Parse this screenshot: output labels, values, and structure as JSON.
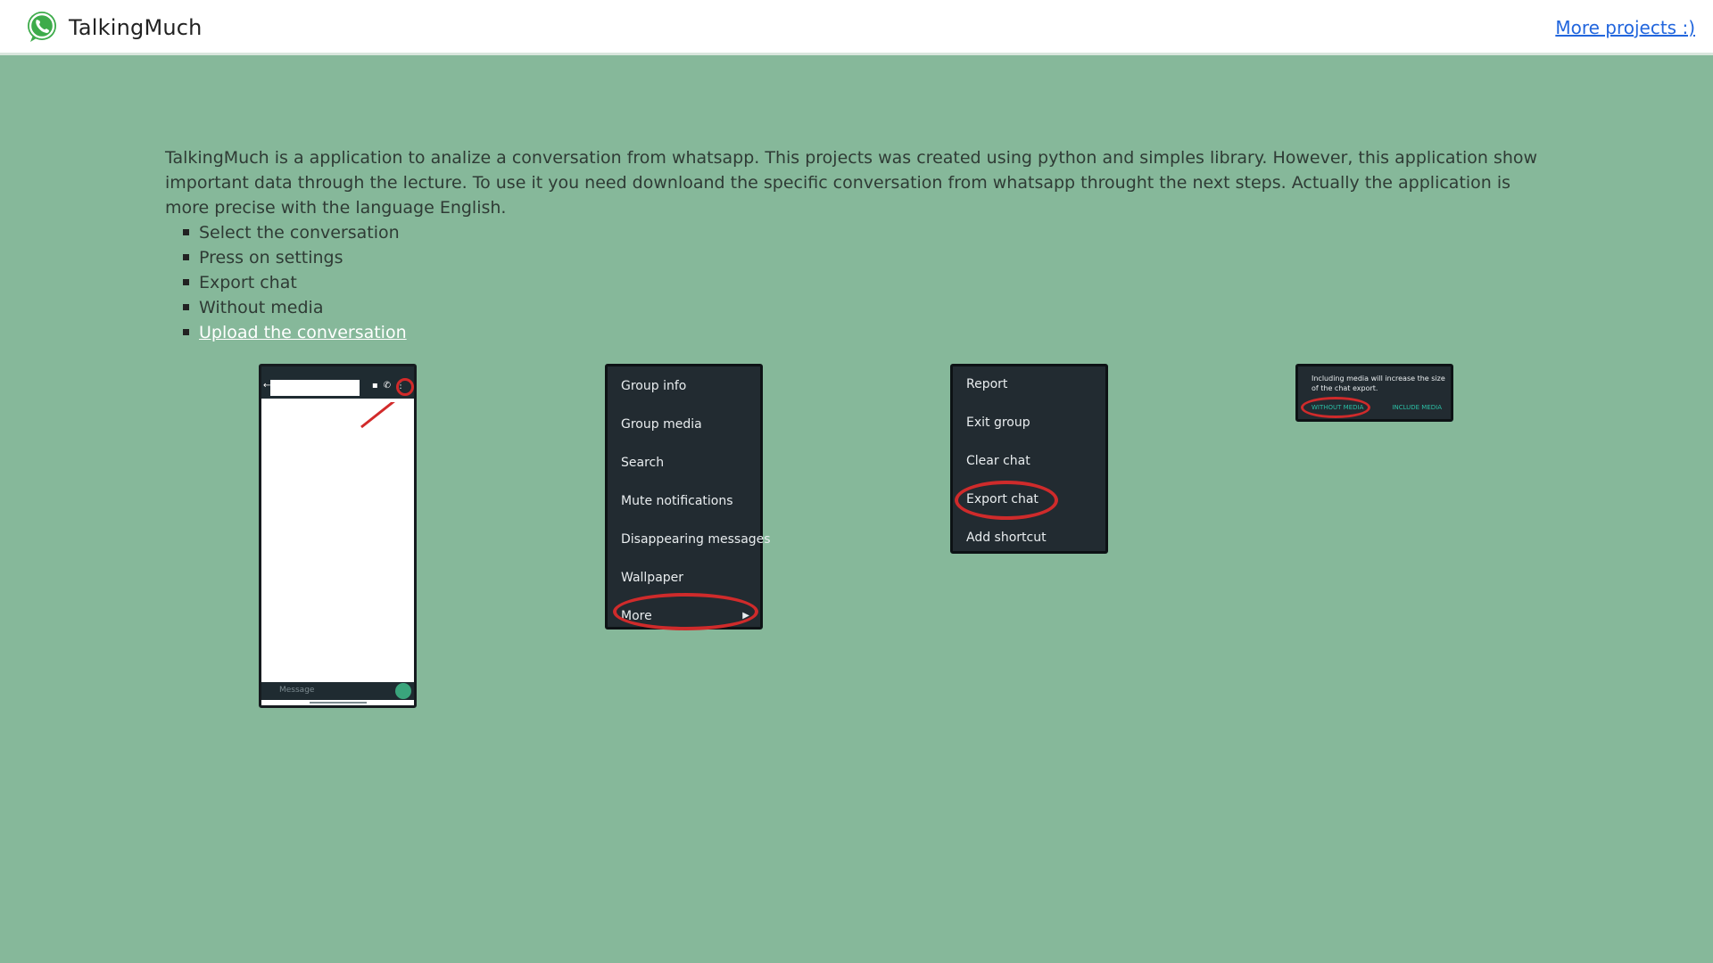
{
  "header": {
    "brand": "TalkingMuch",
    "more_link": "More projects :)"
  },
  "intro": {
    "text": "TalkingMuch is a application to analize a conversation from whatsapp. This projects was created using python and simples library. However, this application show important data through the lecture. To use it you need downloand the specific conversation from whatsapp throught the next steps. Actually the application is more precise with the language English.",
    "steps": [
      "Select the conversation",
      "Press on settings",
      "Export chat",
      "Without media"
    ],
    "upload_link": "Upload the conversation"
  },
  "screenshot1": {
    "input_placeholder": "Message"
  },
  "screenshot2": {
    "items": [
      "Group info",
      "Group media",
      "Search",
      "Mute notifications",
      "Disappearing messages",
      "Wallpaper",
      "More"
    ]
  },
  "screenshot3": {
    "items": [
      "Report",
      "Exit group",
      "Clear chat",
      "Export chat",
      "Add shortcut"
    ]
  },
  "screenshot4": {
    "text": "Including media will increase the size of the chat export.",
    "button_without": "WITHOUT MEDIA",
    "button_include": "INCLUDE MEDIA"
  },
  "colors": {
    "background": "#86b89a",
    "header": "#ffffff",
    "link": "#2266dd",
    "highlight": "#cf2b2b"
  }
}
